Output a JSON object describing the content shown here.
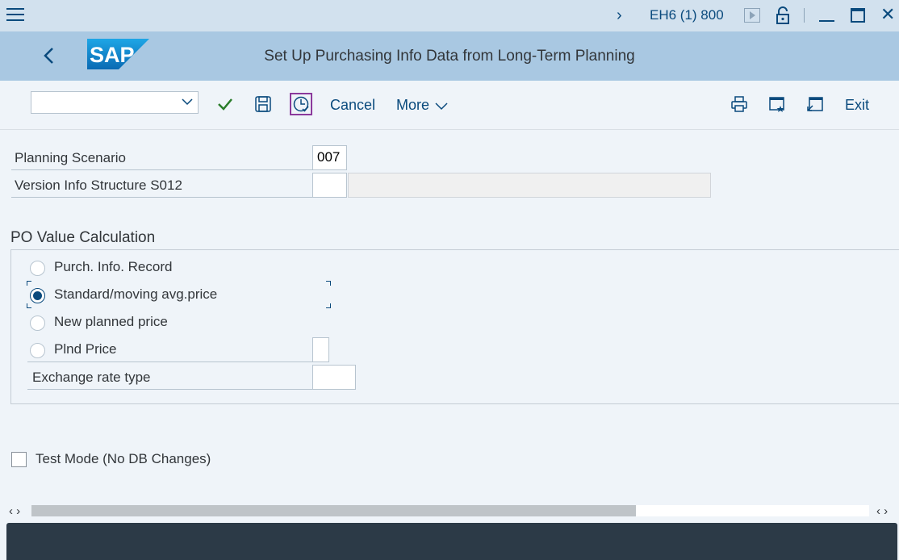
{
  "system": {
    "info": "EH6 (1) 800"
  },
  "header": {
    "logo_text": "SAP",
    "title": "Set Up Purchasing Info Data from Long-Term Planning"
  },
  "toolbar": {
    "command_field_value": "",
    "cancel_label": "Cancel",
    "more_label": "More",
    "exit_label": "Exit"
  },
  "fields": {
    "planning_scenario": {
      "label": "Planning Scenario",
      "value": "007"
    },
    "version_info": {
      "label": "Version Info Structure S012",
      "value": "",
      "description": ""
    }
  },
  "po_value": {
    "title": "PO Value Calculation",
    "options": [
      {
        "label": "Purch. Info. Record",
        "selected": false
      },
      {
        "label": "Standard/moving avg.price",
        "selected": true
      },
      {
        "label": "New planned price",
        "selected": false
      },
      {
        "label": "Plnd Price",
        "selected": false
      }
    ],
    "plnd_price_value": "",
    "exchange_rate": {
      "label": "Exchange rate type",
      "value": ""
    }
  },
  "test_mode": {
    "label": "Test Mode (No DB Changes)",
    "checked": false
  },
  "colors": {
    "accent": "#0a4a7d",
    "title_bar": "#a9c8e2",
    "system_bar": "#d2e1ee",
    "background": "#eff4f9",
    "footer": "#2c3a47",
    "focus": "#8b3a9c",
    "confirm": "#2b7d2b"
  }
}
